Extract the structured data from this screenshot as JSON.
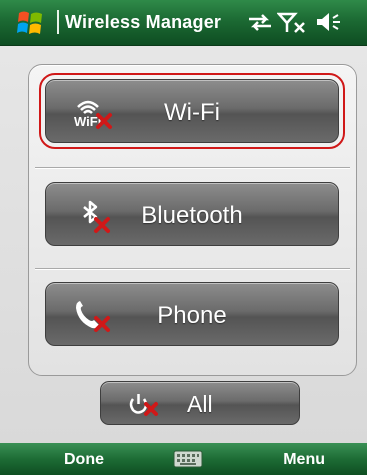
{
  "titlebar": {
    "title": "Wireless Manager",
    "icons": [
      "start-flag-icon",
      "data-sync-icon",
      "no-signal-icon",
      "volume-icon"
    ]
  },
  "buttons": {
    "wifi": {
      "label": "Wi-Fi",
      "icon": "wifi-off-icon",
      "icon_text": "WiFi",
      "selected": true
    },
    "bluetooth": {
      "label": "Bluetooth",
      "icon": "bluetooth-off-icon"
    },
    "phone": {
      "label": "Phone",
      "icon": "phone-off-icon"
    },
    "all": {
      "label": "All",
      "icon": "power-off-icon"
    }
  },
  "softkeys": {
    "left": "Done",
    "right": "Menu",
    "center_icon": "keyboard-icon"
  },
  "colors": {
    "titlebar_green": "#1c6a33",
    "selection_outline": "#d01818",
    "disabled_x": "#d01818"
  }
}
